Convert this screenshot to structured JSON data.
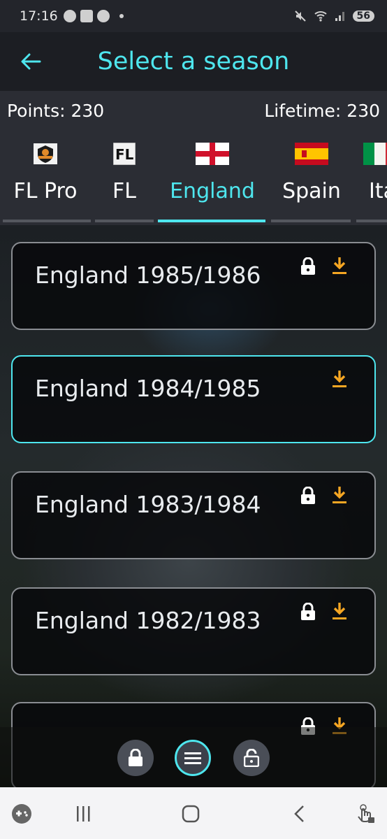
{
  "status_bar": {
    "time": "17:16",
    "battery": "56"
  },
  "app_bar": {
    "title": "Select a season",
    "back_icon": "arrow-left-icon"
  },
  "points": {
    "points_label": "Points: 230",
    "lifetime_label": "Lifetime: 230"
  },
  "tabs": [
    {
      "label": "FL Pro",
      "icon": "fl-pro-badge-icon"
    },
    {
      "label": "FL",
      "icon": "fl-logo-icon"
    },
    {
      "label": "England",
      "icon": "england-flag-icon",
      "active": true
    },
    {
      "label": "Spain",
      "icon": "spain-flag-icon"
    },
    {
      "label": "Ita",
      "icon": "italy-flag-icon"
    }
  ],
  "seasons": [
    {
      "name": "England 1985/1986",
      "locked": true
    },
    {
      "name": "England 1984/1985",
      "locked": false,
      "selected": true
    },
    {
      "name": "England 1983/1984",
      "locked": true
    },
    {
      "name": "England 1982/1983",
      "locked": true
    },
    {
      "name": "",
      "locked": true
    }
  ],
  "bottom_tools": [
    "lock-icon",
    "menu-icon",
    "unlock-icon"
  ],
  "nav_bar": [
    "game-controller-icon",
    "recent-apps-icon",
    "home-icon",
    "back-icon",
    "touch-gesture-icon"
  ],
  "colors": {
    "accent": "#4ee6ee",
    "download": "#f5a623",
    "card_border": "#8a8d92"
  }
}
